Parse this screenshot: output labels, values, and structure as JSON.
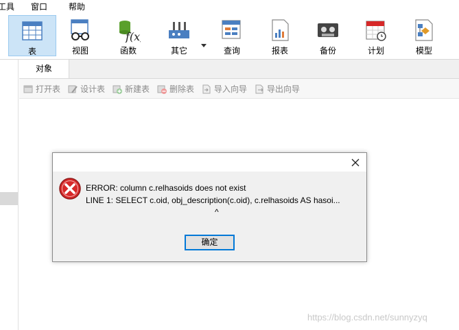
{
  "menu": {
    "items": [
      "工具",
      "窗口",
      "帮助"
    ]
  },
  "toolbar": {
    "items": [
      {
        "label": "表",
        "icon": "table-icon"
      },
      {
        "label": "视图",
        "icon": "view-icon"
      },
      {
        "label": "函数",
        "icon": "function-icon"
      },
      {
        "label": "其它",
        "icon": "other-icon"
      },
      {
        "label": "查询",
        "icon": "query-icon"
      },
      {
        "label": "报表",
        "icon": "report-icon"
      },
      {
        "label": "备份",
        "icon": "backup-icon"
      },
      {
        "label": "计划",
        "icon": "schedule-icon"
      },
      {
        "label": "模型",
        "icon": "model-icon"
      }
    ],
    "active_index": 0
  },
  "objects": {
    "tab_label": "对象",
    "actions": [
      "打开表",
      "设计表",
      "新建表",
      "删除表",
      "导入向导",
      "导出向导"
    ]
  },
  "dialog": {
    "line1": "ERROR:  column c.relhasoids does not exist",
    "line2": "LINE 1: SELECT c.oid, obj_description(c.oid),  c.relhasoids AS hasoi...",
    "line3": "^",
    "ok_label": "确定",
    "close_glyph": "✕",
    "accent": "#0078d7",
    "error_color": "#d62828"
  },
  "watermark": "https://blog.csdn.net/sunnyzyq"
}
